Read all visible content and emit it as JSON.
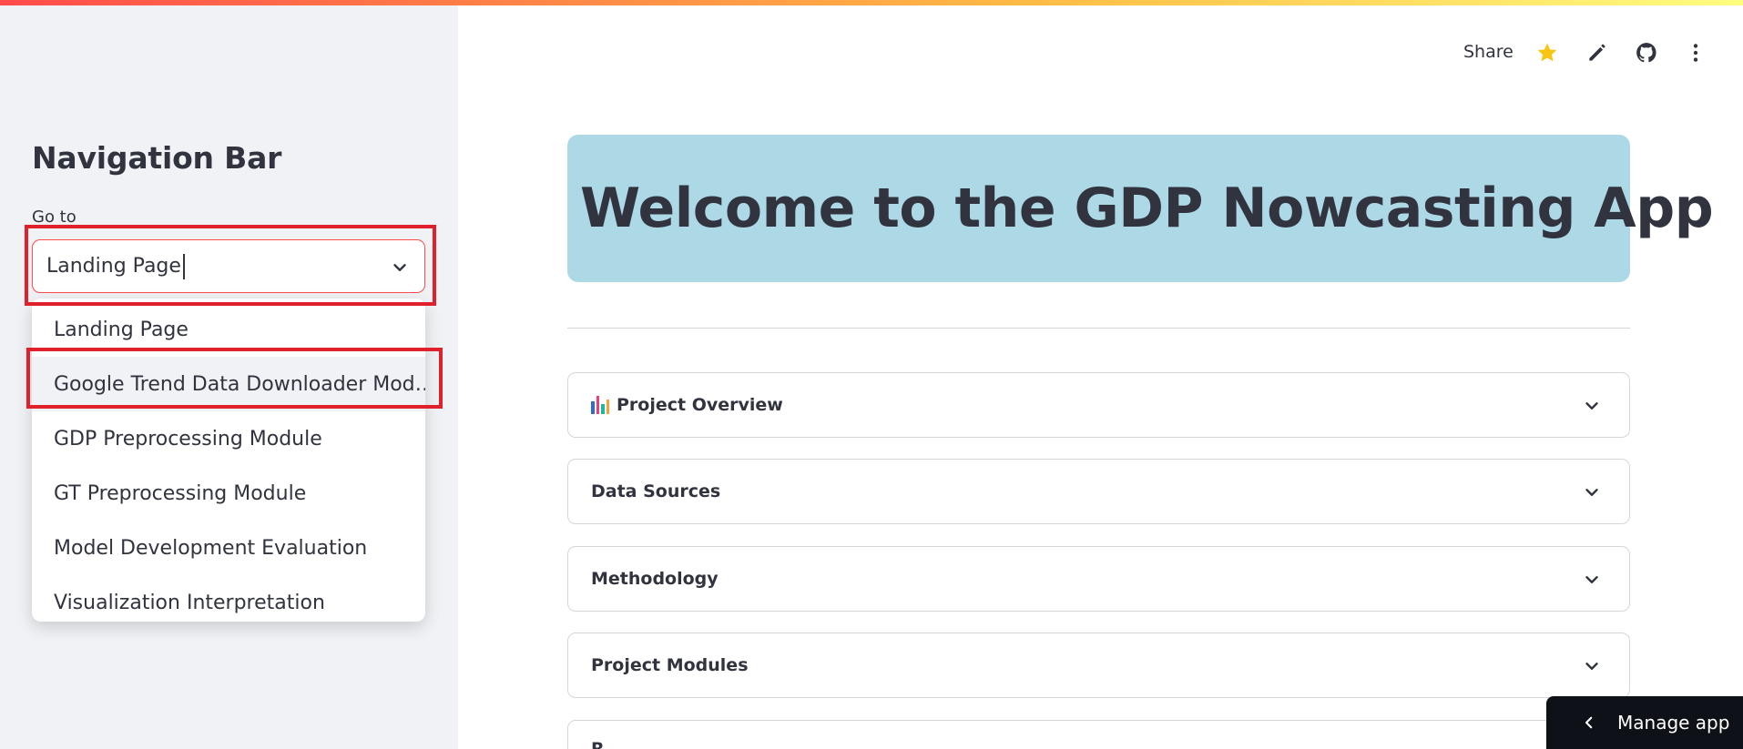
{
  "sidebar": {
    "title": "Navigation Bar",
    "goto_label": "Go to",
    "select_value": "Landing Page",
    "options": [
      "Landing Page",
      "Google Trend Data Downloader Mod…",
      "GDP Preprocessing Module",
      "GT Preprocessing Module",
      "Model Development Evaluation",
      "Visualization Interpretation"
    ]
  },
  "header": {
    "share_label": "Share",
    "icons": [
      "star-icon",
      "edit-icon",
      "github-icon",
      "more-icon"
    ],
    "star_color": "#f9c513"
  },
  "main": {
    "banner_title": "Welcome to the GDP Nowcasting App",
    "banner_color": "#add8e6",
    "expanders": [
      "Project Overview",
      "Data Sources",
      "Methodology",
      "Project Modules",
      "R"
    ]
  },
  "manage_app": {
    "label": "Manage app"
  },
  "colors": {
    "accent": "#ff4b4b",
    "highlight": "#e0202a",
    "sidebar_bg": "#f0f2f6"
  }
}
